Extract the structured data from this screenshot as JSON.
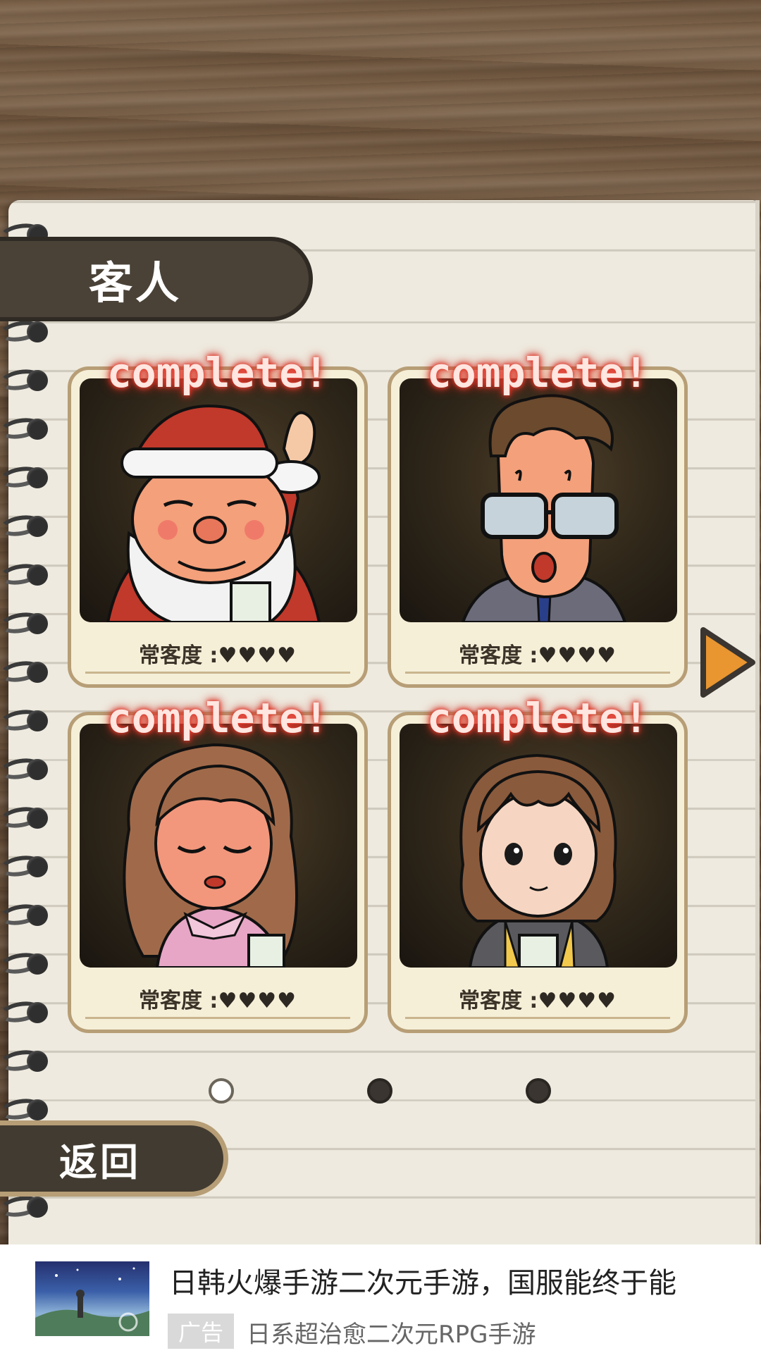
{
  "screen": {
    "title": "客人",
    "back_label": "返回"
  },
  "cards": [
    {
      "status": "complete!",
      "regular_label": "常客度 :",
      "hearts_text": "♥♥♥♥",
      "hearts": 4,
      "character": "santa-claus"
    },
    {
      "status": "complete!",
      "regular_label": "常客度 :",
      "hearts_text": "♥♥♥♥",
      "hearts": 4,
      "character": "businessman-glasses"
    },
    {
      "status": "complete!",
      "regular_label": "常客度 :",
      "hearts_text": "♥♥♥♥",
      "hearts": 4,
      "character": "woman-pink-blouse"
    },
    {
      "status": "complete!",
      "regular_label": "常客度 :",
      "hearts_text": "♥♥♥♥",
      "hearts": 4,
      "character": "girl-bob-hair"
    }
  ],
  "pagination": {
    "current_page": 1,
    "total_pages": 3
  },
  "next_icon": "play-triangle-icon",
  "ad": {
    "title": "日韩火爆手游二次元手游，国服能终于能",
    "badge": "广告",
    "subtitle": "日系超治愈二次元RPG手游"
  },
  "colors": {
    "complete_glow": "#e23b2e",
    "tab_dark": "#4a4237",
    "card_border": "#b79e76",
    "arrow_orange": "#e99530"
  }
}
